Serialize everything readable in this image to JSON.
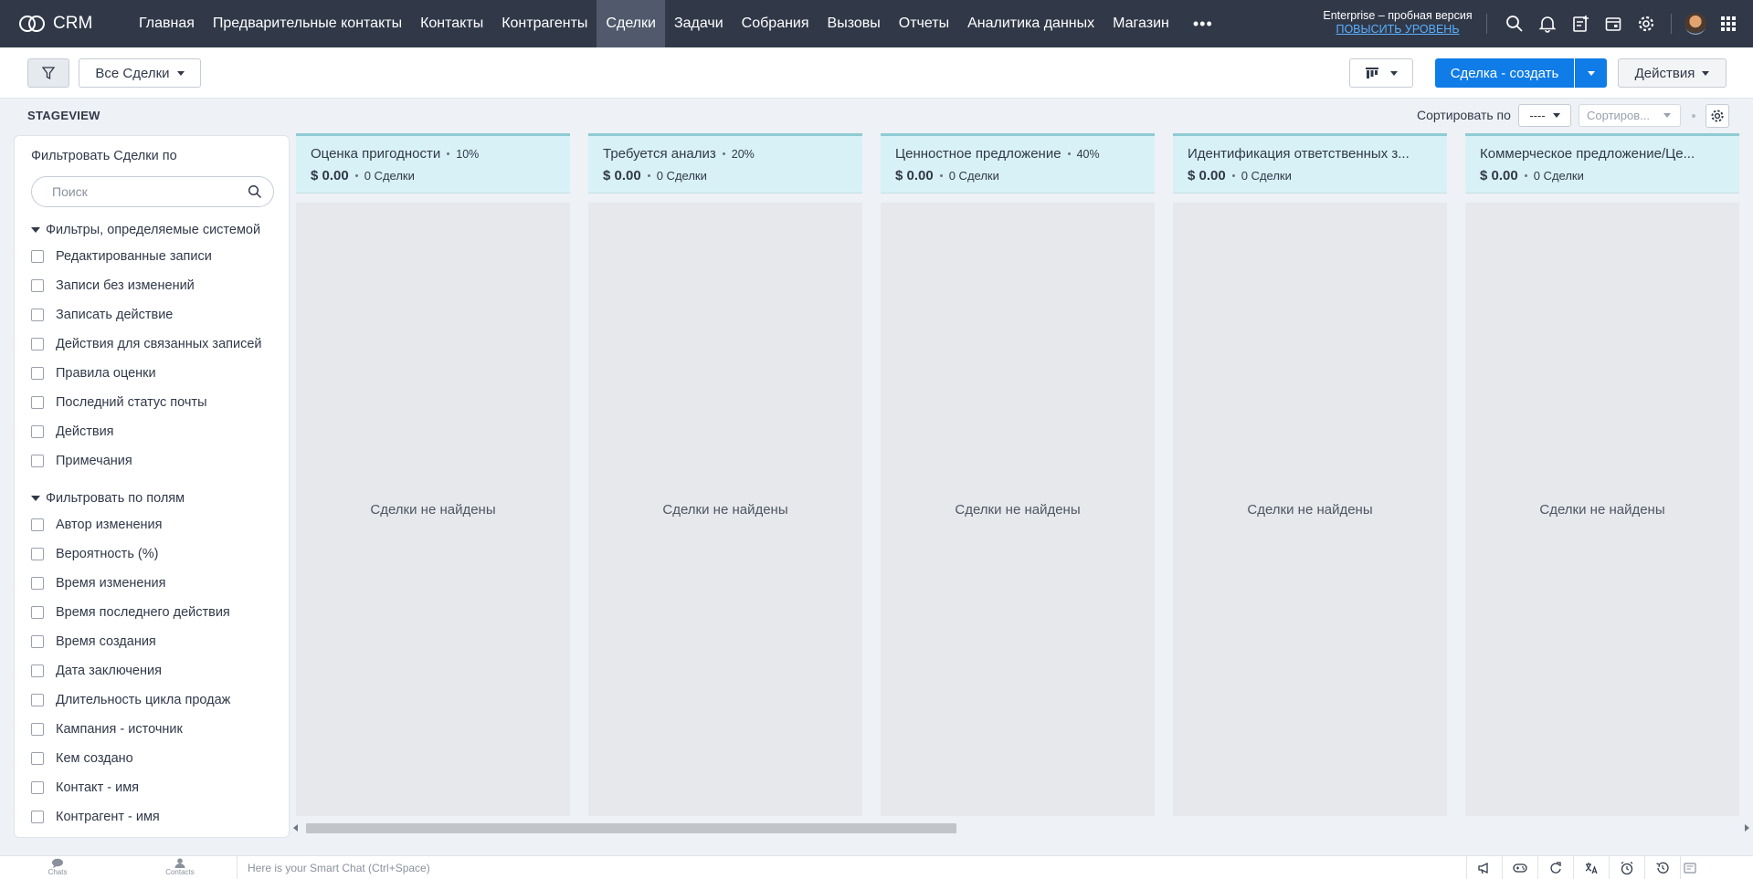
{
  "app": {
    "name": "CRM"
  },
  "nav": {
    "items": [
      "Главная",
      "Предварительные контакты",
      "Контакты",
      "Контрагенты",
      "Сделки",
      "Задачи",
      "Собрания",
      "Вызовы",
      "Отчеты",
      "Аналитика данных",
      "Магазин"
    ],
    "active": "Сделки",
    "more_label": "•••"
  },
  "plan": {
    "label": "Enterprise – пробная версия",
    "upgrade": "ПОВЫСИТЬ УРОВЕНЬ"
  },
  "toolbar": {
    "view_selector": "Все Сделки",
    "create_button": "Сделка - создать",
    "actions_button": "Действия"
  },
  "stageview": {
    "label": "STAGEVIEW",
    "sort_label": "Сортировать по",
    "sort_field": "----",
    "sort_order_placeholder": "Сортиров..."
  },
  "filter_panel": {
    "title": "Фильтровать Сделки по",
    "search_placeholder": "Поиск",
    "system_section": "Фильтры, определяемые системой",
    "system_filters": [
      "Редактированные записи",
      "Записи без изменений",
      "Записать действие",
      "Действия для связанных записей",
      "Правила оценки",
      "Последний статус почты",
      "Действия",
      "Примечания"
    ],
    "field_section": "Фильтровать по полям",
    "field_filters": [
      "Автор изменения",
      "Вероятность (%)",
      "Время изменения",
      "Время последнего действия",
      "Время создания",
      "Дата заключения",
      "Длительность цикла продаж",
      "Кампания - источник",
      "Кем создано",
      "Контакт - имя",
      "Контрагент - имя"
    ]
  },
  "stages": [
    {
      "name": "Оценка пригодности",
      "percent": "10%",
      "amount": "$ 0.00",
      "count": "0 Сделки",
      "empty": "Сделки не найдены"
    },
    {
      "name": "Требуется анализ",
      "percent": "20%",
      "amount": "$ 0.00",
      "count": "0 Сделки",
      "empty": "Сделки не найдены"
    },
    {
      "name": "Ценностное предложение",
      "percent": "40%",
      "amount": "$ 0.00",
      "count": "0 Сделки",
      "empty": "Сделки не найдены"
    },
    {
      "name": "Идентификация ответственных з...",
      "percent": "",
      "amount": "$ 0.00",
      "count": "0 Сделки",
      "empty": "Сделки не найдены"
    },
    {
      "name": "Коммерческое предложение/Це...",
      "percent": "",
      "amount": "$ 0.00",
      "count": "0 Сделки",
      "empty": "Сделки не найдены"
    }
  ],
  "bottom_bar": {
    "tabs": [
      "Chats",
      "Contacts"
    ],
    "smart_chat_placeholder": "Here is your Smart Chat (Ctrl+Space)",
    "icons": [
      "megaphone-icon",
      "gamepad-icon",
      "refresh-icon",
      "translate-icon",
      "alarm-icon",
      "history-icon",
      "notes-icon"
    ]
  },
  "colors": {
    "topnav": "#313949",
    "primary": "#0f7ce8",
    "stage_header": "#d8f1f6",
    "stage_border": "#8fcbd3"
  }
}
